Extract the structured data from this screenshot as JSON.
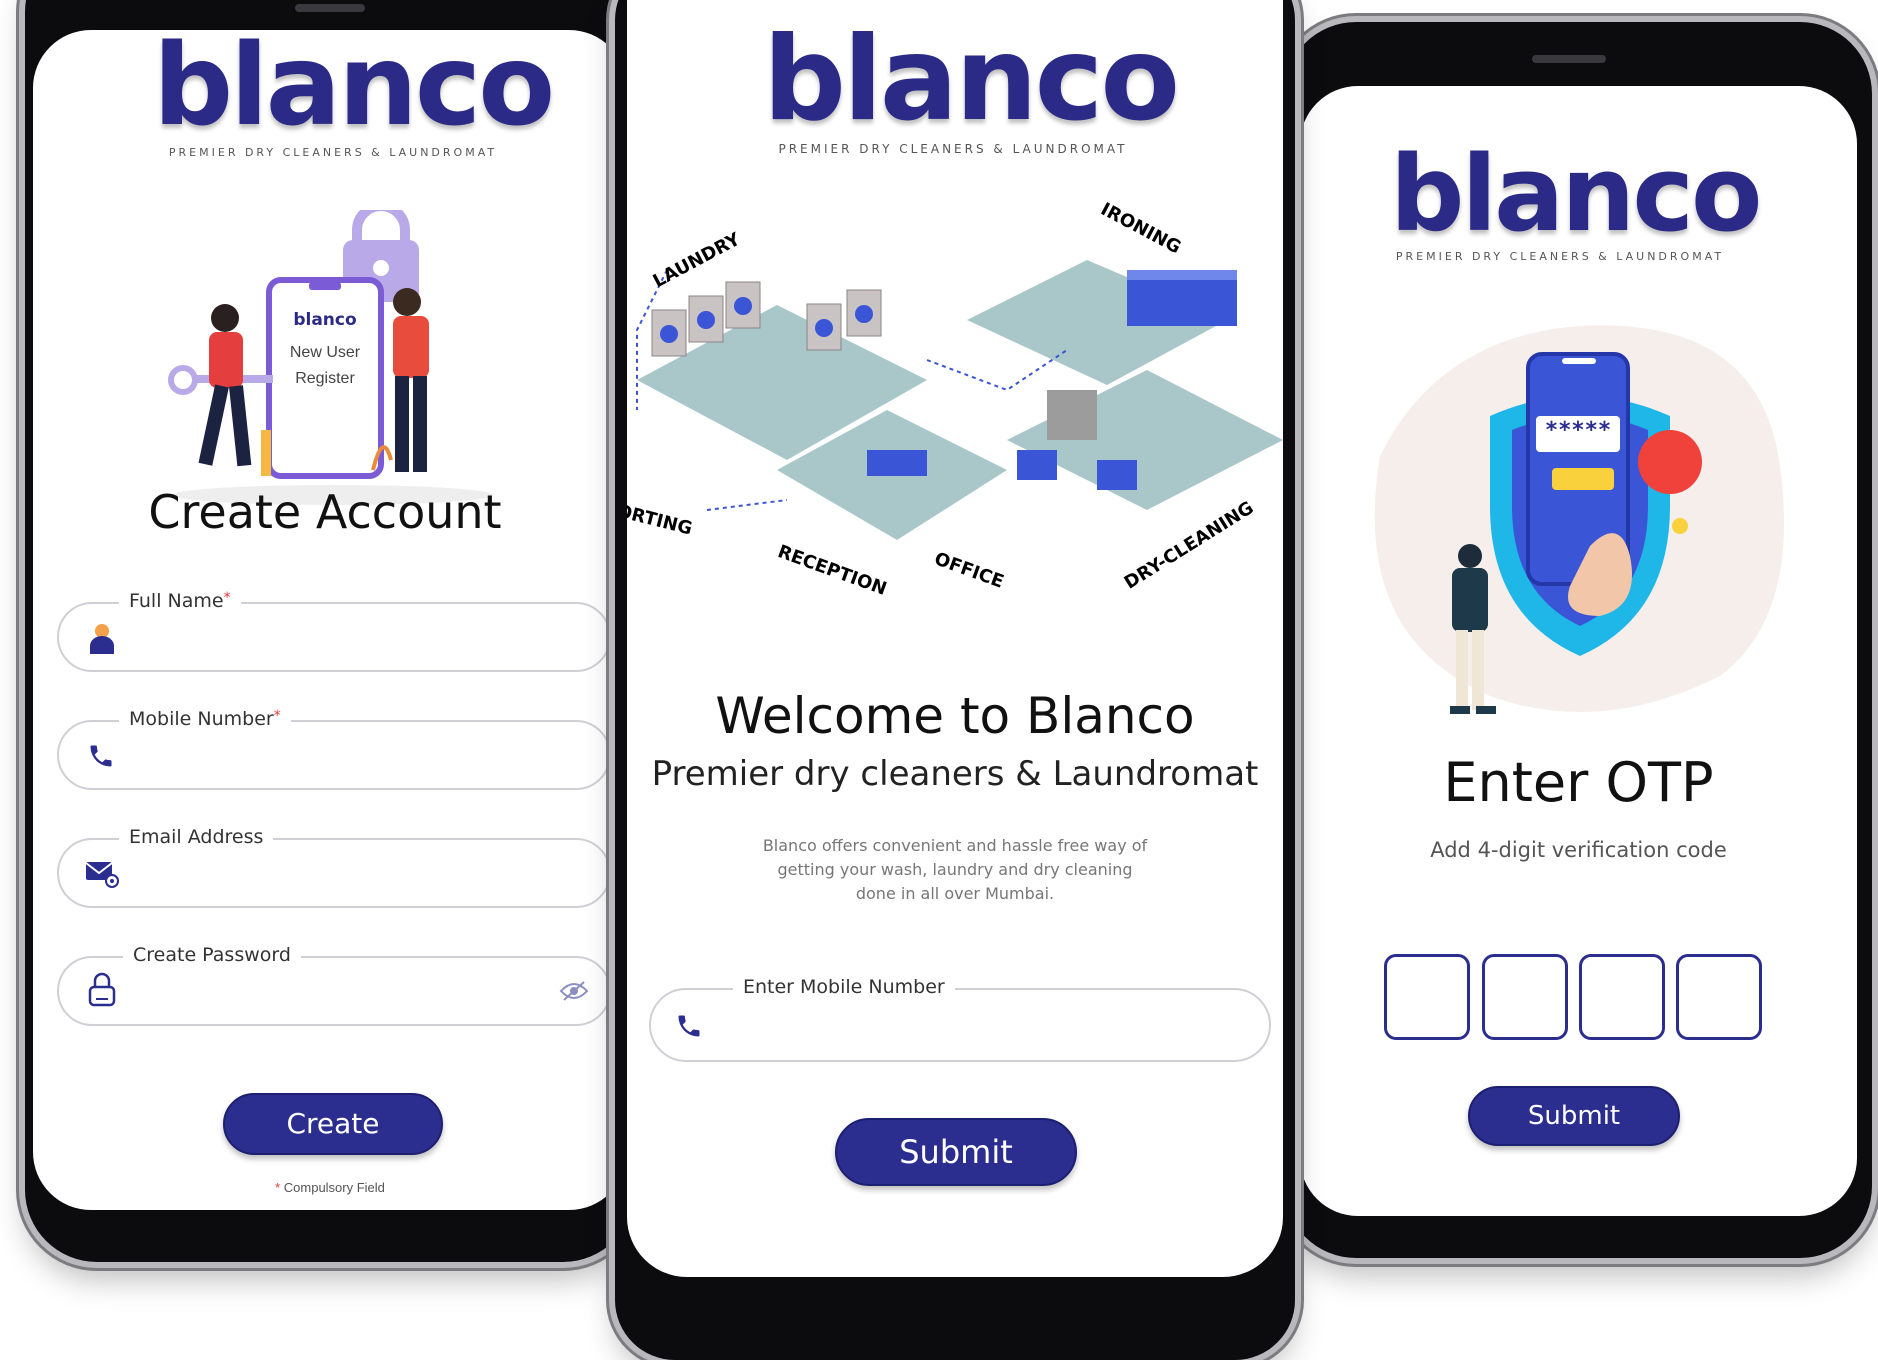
{
  "brand": {
    "name": "blanco",
    "tagline": "PREMIER DRY CLEANERS & LAUNDROMAT"
  },
  "register": {
    "illustration_logo": "blanco",
    "illustration_line1": "New User",
    "illustration_line2": "Register",
    "title": "Create Account",
    "fields": [
      {
        "label": "Full Name",
        "required": "*",
        "icon": "user-icon"
      },
      {
        "label": "Mobile Number",
        "required": "*",
        "icon": "phone-icon"
      },
      {
        "label": "Email Address",
        "required": "",
        "icon": "email-icon"
      },
      {
        "label": "Create Password",
        "required": "",
        "icon": "lock-icon",
        "trailing_icon": "eye-off-icon"
      }
    ],
    "button": "Create",
    "footnote_mark": "*",
    "footnote": "Compulsory Field"
  },
  "welcome": {
    "illustration_labels": [
      "LAUNDRY",
      "IRONING",
      "SORTING",
      "RECEPTION",
      "OFFICE",
      "DRY-CLEANING"
    ],
    "title": "Welcome to Blanco",
    "subtitle": "Premier dry cleaners & Laundromat",
    "description_line1": "Blanco offers convenient and hassle free way of",
    "description_line2": "getting your wash, laundry and dry cleaning",
    "description_line3": "done in all over Mumbai.",
    "field_label": "Enter Mobile Number",
    "button": "Submit"
  },
  "otp": {
    "illustration_code": "*****",
    "title": "Enter OTP",
    "subtitle": "Add 4-digit verification code",
    "digits": [
      "",
      "",
      "",
      ""
    ],
    "button": "Submit"
  },
  "colors": {
    "brand": "#2b2a86",
    "button": "#2b2d8f",
    "required": "#e03a3a"
  }
}
